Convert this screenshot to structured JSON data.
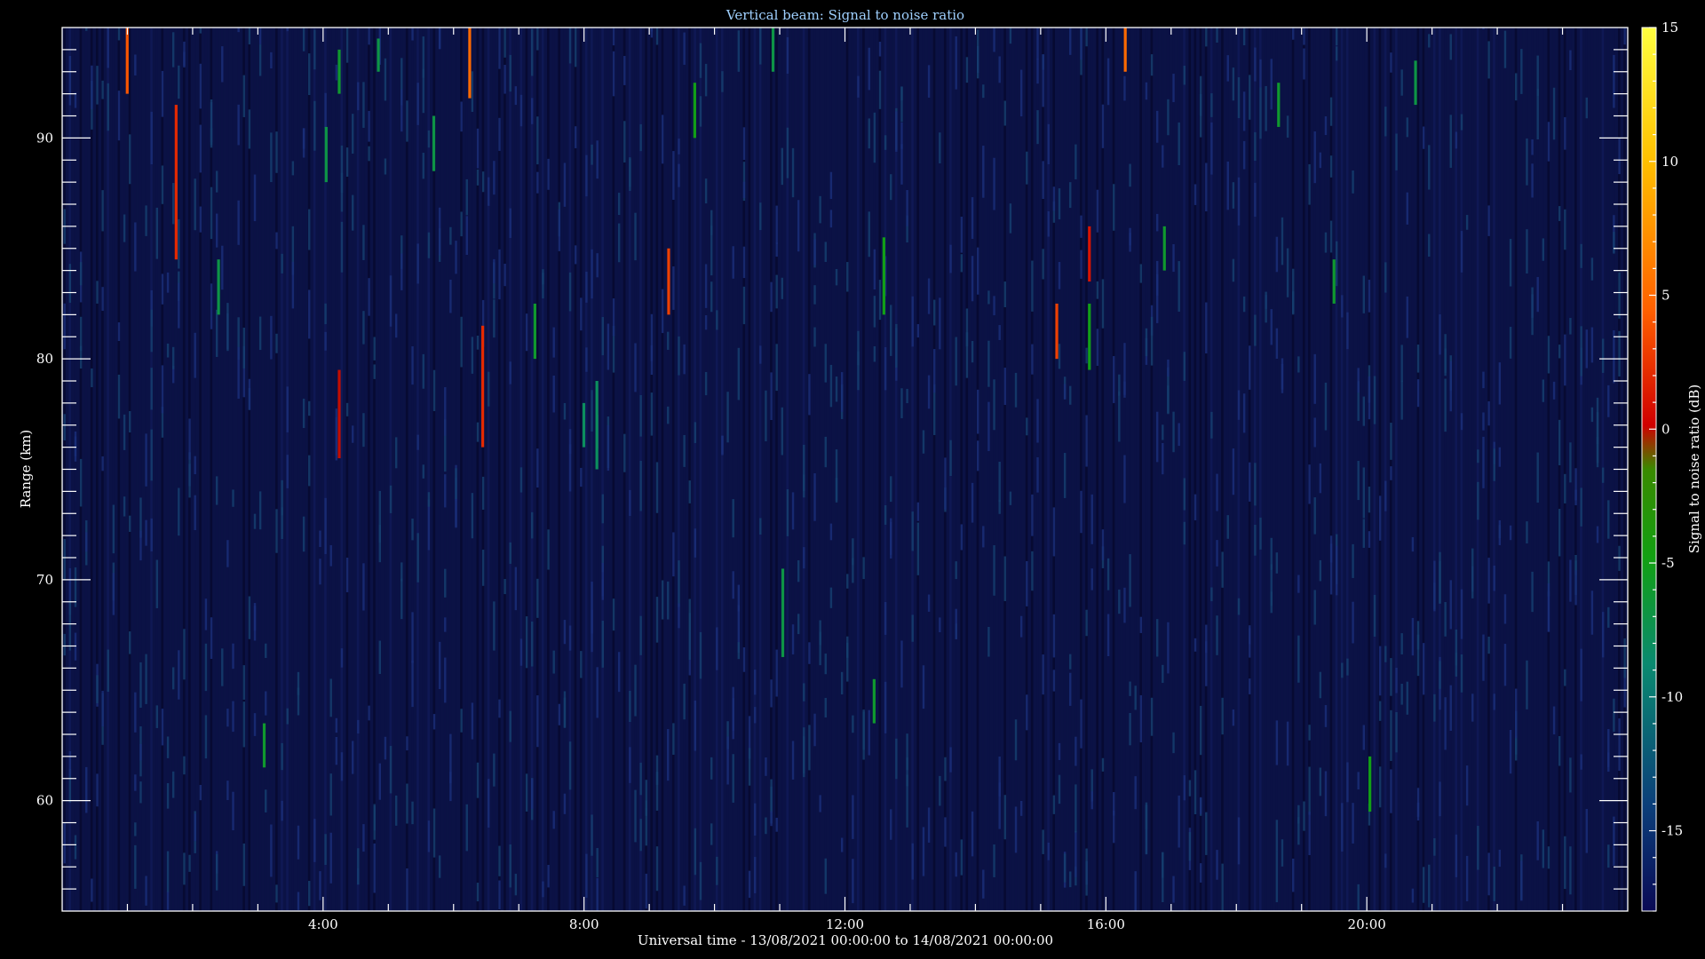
{
  "chart_data": {
    "type": "heatmap",
    "title": "Vertical beam: Signal to noise ratio",
    "xlabel": "Universal time - 13/08/2021 00:00:00 to 14/08/2021 00:00:00",
    "ylabel": "Range (km)",
    "colorbar_label": "Signal to noise ratio (dB)",
    "x_range_hours": [
      0,
      24
    ],
    "x_ticks": [
      {
        "hour": 4,
        "label": "4:00"
      },
      {
        "hour": 8,
        "label": "8:00"
      },
      {
        "hour": 12,
        "label": "12:00"
      },
      {
        "hour": 16,
        "label": "16:00"
      },
      {
        "hour": 20,
        "label": "20:00"
      }
    ],
    "y_range_km": [
      55,
      95
    ],
    "y_ticks": [
      60,
      70,
      80,
      90
    ],
    "colorbar_range_db": [
      -18,
      15
    ],
    "colorbar_ticks": [
      15,
      10,
      5,
      0,
      -5,
      -10,
      -15
    ],
    "colormap": [
      "#0a0a55",
      "#0b3f7a",
      "#0a8a70",
      "#12a012",
      "#3a8a00",
      "#d00000",
      "#ff6000",
      "#ffc000",
      "#ffff40"
    ],
    "background_db": -16,
    "features": [
      {
        "t": 1.0,
        "r0": 92,
        "r1": 95,
        "db": 4
      },
      {
        "t": 1.75,
        "r0": 84.5,
        "r1": 91.5,
        "db": 2
      },
      {
        "t": 2.4,
        "r0": 82,
        "r1": 84.5,
        "db": -7
      },
      {
        "t": 3.1,
        "r0": 61.5,
        "r1": 63.5,
        "db": -6
      },
      {
        "t": 4.05,
        "r0": 88,
        "r1": 90.5,
        "db": -7
      },
      {
        "t": 4.25,
        "r0": 75.5,
        "r1": 79.5,
        "db": 0
      },
      {
        "t": 4.25,
        "r0": 92,
        "r1": 94,
        "db": -6
      },
      {
        "t": 4.85,
        "r0": 93,
        "r1": 94.5,
        "db": -7
      },
      {
        "t": 5.7,
        "r0": 88.5,
        "r1": 91,
        "db": -7
      },
      {
        "t": 6.25,
        "r0": 91.8,
        "r1": 95,
        "db": 5
      },
      {
        "t": 6.45,
        "r0": 76,
        "r1": 81.5,
        "db": 2
      },
      {
        "t": 7.25,
        "r0": 80,
        "r1": 82.5,
        "db": -6
      },
      {
        "t": 8.0,
        "r0": 76,
        "r1": 78,
        "db": -8
      },
      {
        "t": 8.2,
        "r0": 75,
        "r1": 79,
        "db": -8
      },
      {
        "t": 9.3,
        "r0": 82,
        "r1": 85,
        "db": 3
      },
      {
        "t": 9.7,
        "r0": 90,
        "r1": 92.5,
        "db": -5
      },
      {
        "t": 10.9,
        "r0": 93,
        "r1": 95,
        "db": -7
      },
      {
        "t": 11.05,
        "r0": 66.5,
        "r1": 70.5,
        "db": -7
      },
      {
        "t": 12.45,
        "r0": 63.5,
        "r1": 65.5,
        "db": -6
      },
      {
        "t": 12.6,
        "r0": 82,
        "r1": 85.5,
        "db": -5
      },
      {
        "t": 15.25,
        "r0": 80,
        "r1": 82.5,
        "db": 3
      },
      {
        "t": 15.75,
        "r0": 83.5,
        "r1": 86,
        "db": 1
      },
      {
        "t": 15.75,
        "r0": 79.5,
        "r1": 82.5,
        "db": -5
      },
      {
        "t": 16.3,
        "r0": 93,
        "r1": 95,
        "db": 5
      },
      {
        "t": 16.9,
        "r0": 84,
        "r1": 86,
        "db": -6
      },
      {
        "t": 18.65,
        "r0": 90.5,
        "r1": 92.5,
        "db": -6
      },
      {
        "t": 19.5,
        "r0": 82.5,
        "r1": 84.5,
        "db": -6
      },
      {
        "t": 20.05,
        "r0": 59.5,
        "r1": 62,
        "db": -5
      },
      {
        "t": 20.75,
        "r0": 91.5,
        "r1": 93.5,
        "db": -7
      }
    ]
  }
}
